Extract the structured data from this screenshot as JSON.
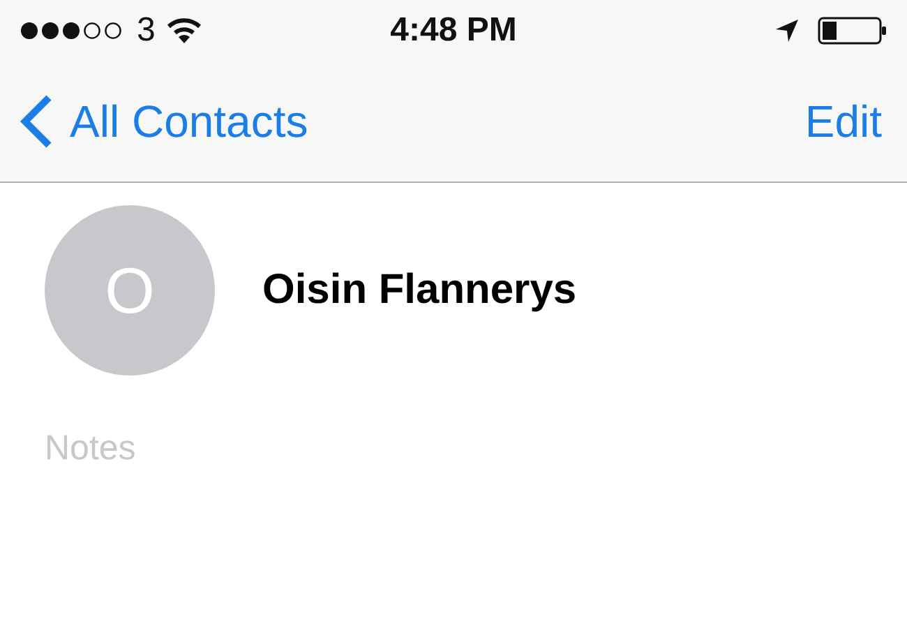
{
  "status_bar": {
    "carrier": "3",
    "time": "4:48 PM"
  },
  "nav_bar": {
    "back": "All Contacts",
    "action": "Edit"
  },
  "contact": {
    "initial": "O",
    "name": "Oisin Flannerys"
  },
  "notes": {
    "placeholder": "Notes"
  }
}
